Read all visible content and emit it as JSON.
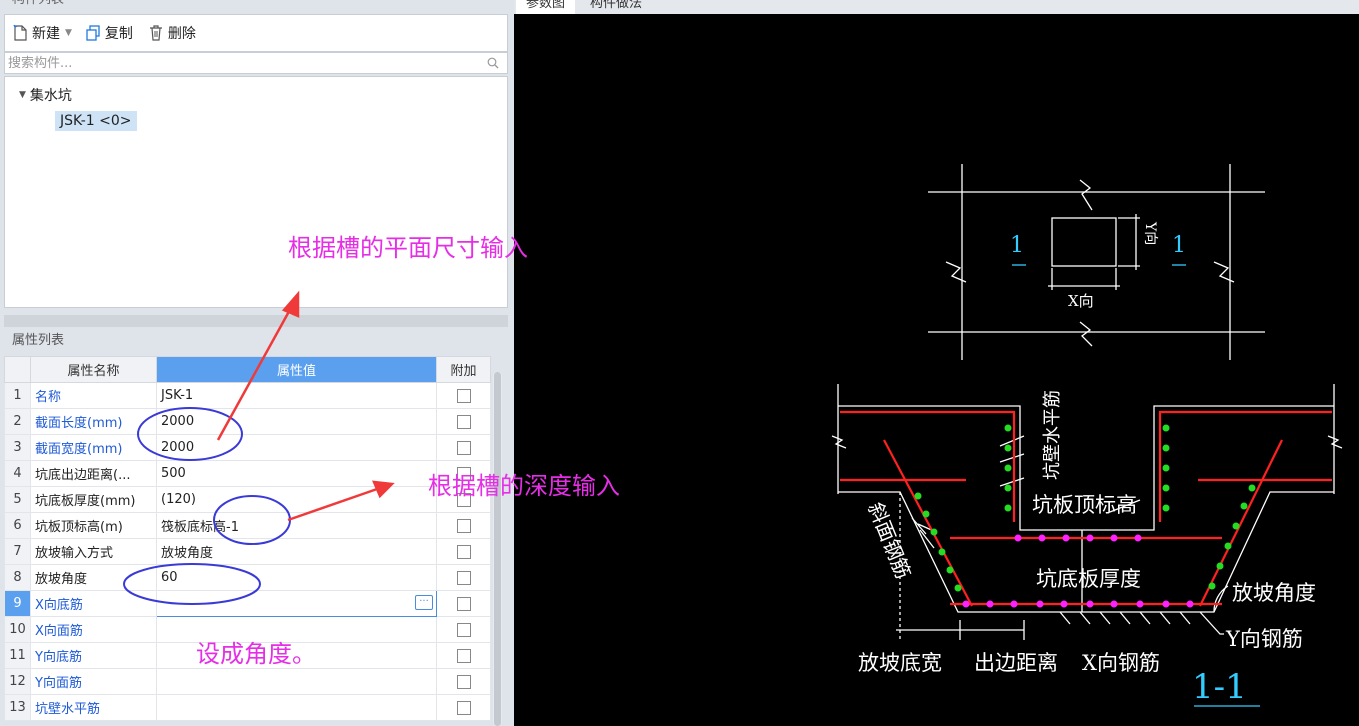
{
  "left_panel": {
    "title": "构件列表",
    "toolbar": {
      "new_label": "新建",
      "copy_label": "复制",
      "delete_label": "删除"
    },
    "search": {
      "placeholder": "搜索构件..."
    },
    "tree": {
      "root_label": "集水坑",
      "child_label": "JSK-1 <0>"
    },
    "props_title": "属性列表",
    "columns": {
      "name": "属性名称",
      "value": "属性值",
      "extra": "附加"
    },
    "rows": [
      {
        "num": "1",
        "name": "名称",
        "value": "JSK-1"
      },
      {
        "num": "2",
        "name": "截面长度(mm)",
        "value": "2000"
      },
      {
        "num": "3",
        "name": "截面宽度(mm)",
        "value": "2000"
      },
      {
        "num": "4",
        "name": "坑底出边距离(...",
        "value": "500"
      },
      {
        "num": "5",
        "name": "坑底板厚度(mm)",
        "value": "(120)"
      },
      {
        "num": "6",
        "name": "坑板顶标高(m)",
        "value": "筏板底标高-1"
      },
      {
        "num": "7",
        "name": "放坡输入方式",
        "value": "放坡角度"
      },
      {
        "num": "8",
        "name": "放坡角度",
        "value": "60"
      },
      {
        "num": "9",
        "name": "X向底筋",
        "value": ""
      },
      {
        "num": "10",
        "name": "X向面筋",
        "value": ""
      },
      {
        "num": "11",
        "name": "Y向底筋",
        "value": ""
      },
      {
        "num": "12",
        "name": "Y向面筋",
        "value": ""
      },
      {
        "num": "13",
        "name": "坑壁水平筋",
        "value": ""
      }
    ]
  },
  "right_panel": {
    "tabs": [
      "参数图",
      "构件做法"
    ],
    "diagram": {
      "section_mark_left": "1",
      "section_mark_right": "1",
      "y_dir": "Y向",
      "x_dir": "X向",
      "wall_horizontal_bar": "坑壁水平筋",
      "pit_slab_top_elev": "坑板顶标高",
      "slope_bar": "斜面钢筋",
      "pit_slab_thickness": "坑底板厚度",
      "slope_angle": "放坡角度",
      "y_bar": "Y向钢筋",
      "slope_bottom_width": "放坡底宽",
      "edge_distance": "出边距离",
      "x_bar": "X向钢筋",
      "section_title": "1-1"
    }
  },
  "annotations": {
    "plan_size": "根据槽的平面尺寸输入",
    "depth": "根据槽的深度输入",
    "angle": "设成角度。"
  },
  "colors": {
    "accent": "#5aa0ef",
    "annotation": "#e62ee6",
    "rebar_red": "#ff2020",
    "rebar_green": "#22dd22",
    "rebar_magenta": "#ff22ff",
    "dim_cyan": "#33ccff"
  }
}
